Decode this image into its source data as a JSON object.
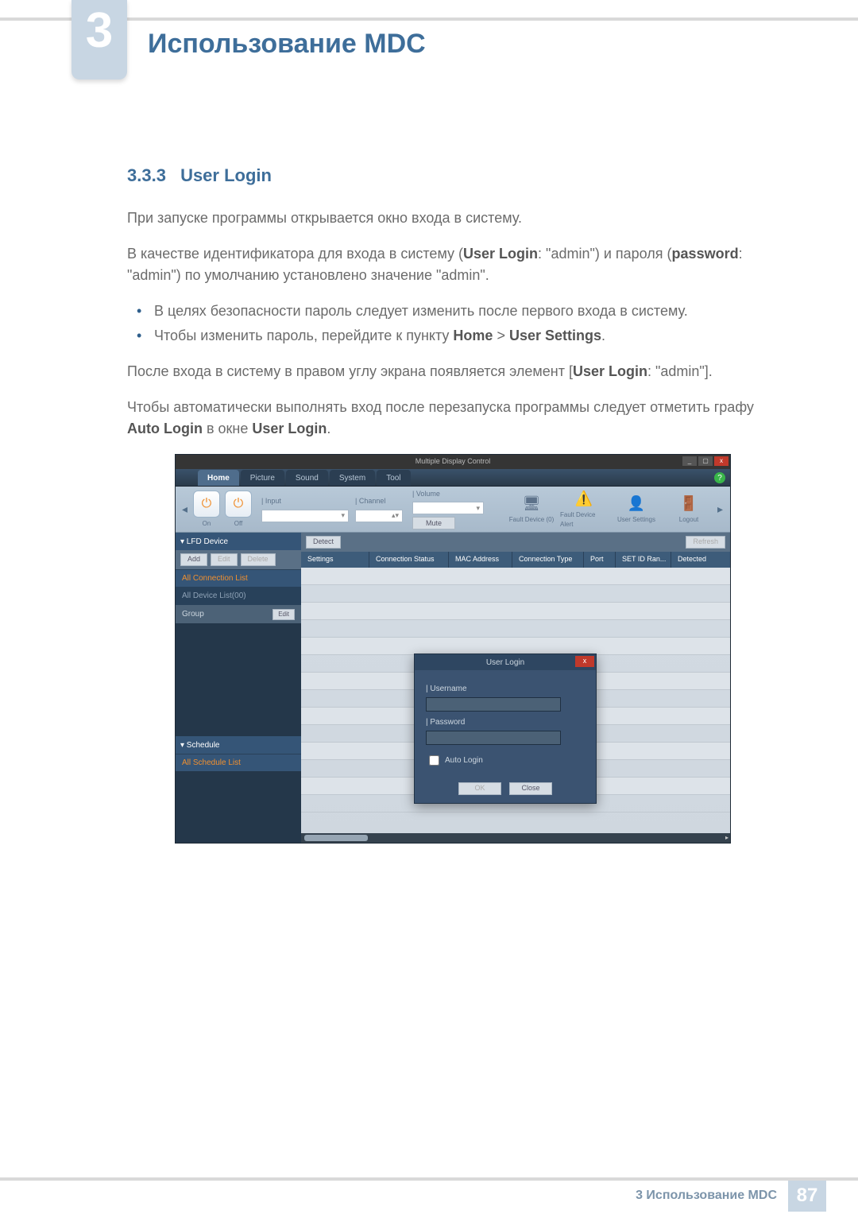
{
  "chapter": {
    "number": "3",
    "title": "Использование MDC"
  },
  "section": {
    "number": "3.3.3",
    "title": "User Login"
  },
  "paragraphs": {
    "p1": "При запуске программы открывается окно входа в систему.",
    "p2_a": "В качестве идентификатора для входа в систему (",
    "p2_bold1": "User Login",
    "p2_b": ": \"admin\") и пароля (",
    "p2_bold2": "password",
    "p2_c": ": \"admin\") по умолчанию установлено значение \"admin\".",
    "bul1": "В целях безопасности пароль следует изменить после первого входа в систему.",
    "bul2_a": "Чтобы изменить пароль, перейдите к пункту ",
    "bul2_home": "Home",
    "bul2_gt": " > ",
    "bul2_us": "User Settings",
    "bul2_end": ".",
    "p3_a": "После входа в систему в правом углу экрана появляется элемент [",
    "p3_bold": "User Login",
    "p3_b": ": \"admin\"].",
    "p4_a": "Чтобы автоматически выполнять вход после перезапуска программы следует отметить графу ",
    "p4_bold1": "Auto Login",
    "p4_mid": " в окне ",
    "p4_bold2": "User Login",
    "p4_end": "."
  },
  "mdc": {
    "window_title": "Multiple Display Control",
    "help": "?",
    "tabs": [
      "Home",
      "Picture",
      "Sound",
      "System",
      "Tool"
    ],
    "active_tab": 0,
    "toolbar": {
      "on_label": "On",
      "off_label": "Off",
      "input_label": "Input",
      "channel_label": "Channel",
      "volume_label": "Volume",
      "mute_label": "Mute",
      "fault_device": "Fault Device (0)",
      "fault_alert": "Fault Device Alert",
      "user_settings": "User Settings",
      "logout": "Logout"
    },
    "sidebar": {
      "lfd_header": "▾ LFD Device",
      "all_connection": "All Connection List",
      "all_device": "All Device List(00)",
      "group": "Group",
      "schedule_header": "▾ Schedule",
      "all_schedule": "All Schedule List"
    },
    "buttons": {
      "add": "Add",
      "edit": "Edit",
      "delete": "Delete",
      "detect": "Detect",
      "refresh": "Refresh"
    },
    "columns": [
      "Settings",
      "Connection Status",
      "MAC Address",
      "Connection Type",
      "Port",
      "SET ID Ran...",
      "Detected"
    ],
    "login": {
      "title": "User Login",
      "username": "Username",
      "password": "Password",
      "auto": "Auto Login",
      "ok": "OK",
      "close": "Close"
    }
  },
  "footer": {
    "text": "3 Использование MDC",
    "page": "87"
  }
}
